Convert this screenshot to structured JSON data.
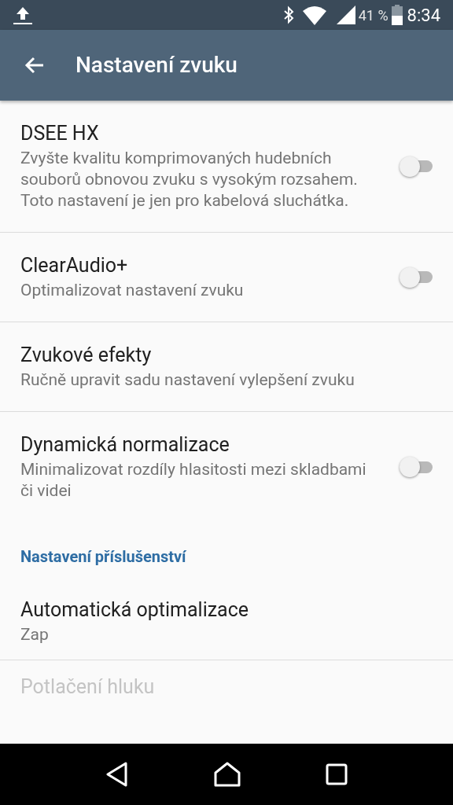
{
  "status_bar": {
    "battery_percent": "41 %",
    "time": "8:34"
  },
  "app_bar": {
    "title": "Nastavení zvuku"
  },
  "items": [
    {
      "kind": "toggle",
      "title": "DSEE HX",
      "subtitle": "Zvyšte kvalitu komprimovaných hudebních souborů obnovou zvuku s vysokým rozsahem. Toto nastavení je jen pro kabelová sluchátka.",
      "on": false,
      "disabled": false,
      "divider": true
    },
    {
      "kind": "toggle",
      "title": "ClearAudio+",
      "subtitle": "Optimalizovat nastavení zvuku",
      "on": false,
      "disabled": false,
      "divider": true
    },
    {
      "kind": "plain",
      "title": "Zvukové efekty",
      "subtitle": "Ručně upravit sadu nastavení vylepšení zvuku",
      "disabled": false,
      "divider": true
    },
    {
      "kind": "toggle",
      "title": "Dynamická normalizace",
      "subtitle": "Minimalizovat rozdíly hlasitosti mezi skladbami či videi",
      "on": false,
      "disabled": false,
      "divider": false
    },
    {
      "kind": "header",
      "title": "Nastavení příslušenství"
    },
    {
      "kind": "plain",
      "title": "Automatická optimalizace",
      "subtitle": "Zap",
      "disabled": false,
      "divider": true
    },
    {
      "kind": "plain",
      "title": "Potlačení hluku",
      "disabled": true,
      "divider": false
    }
  ]
}
